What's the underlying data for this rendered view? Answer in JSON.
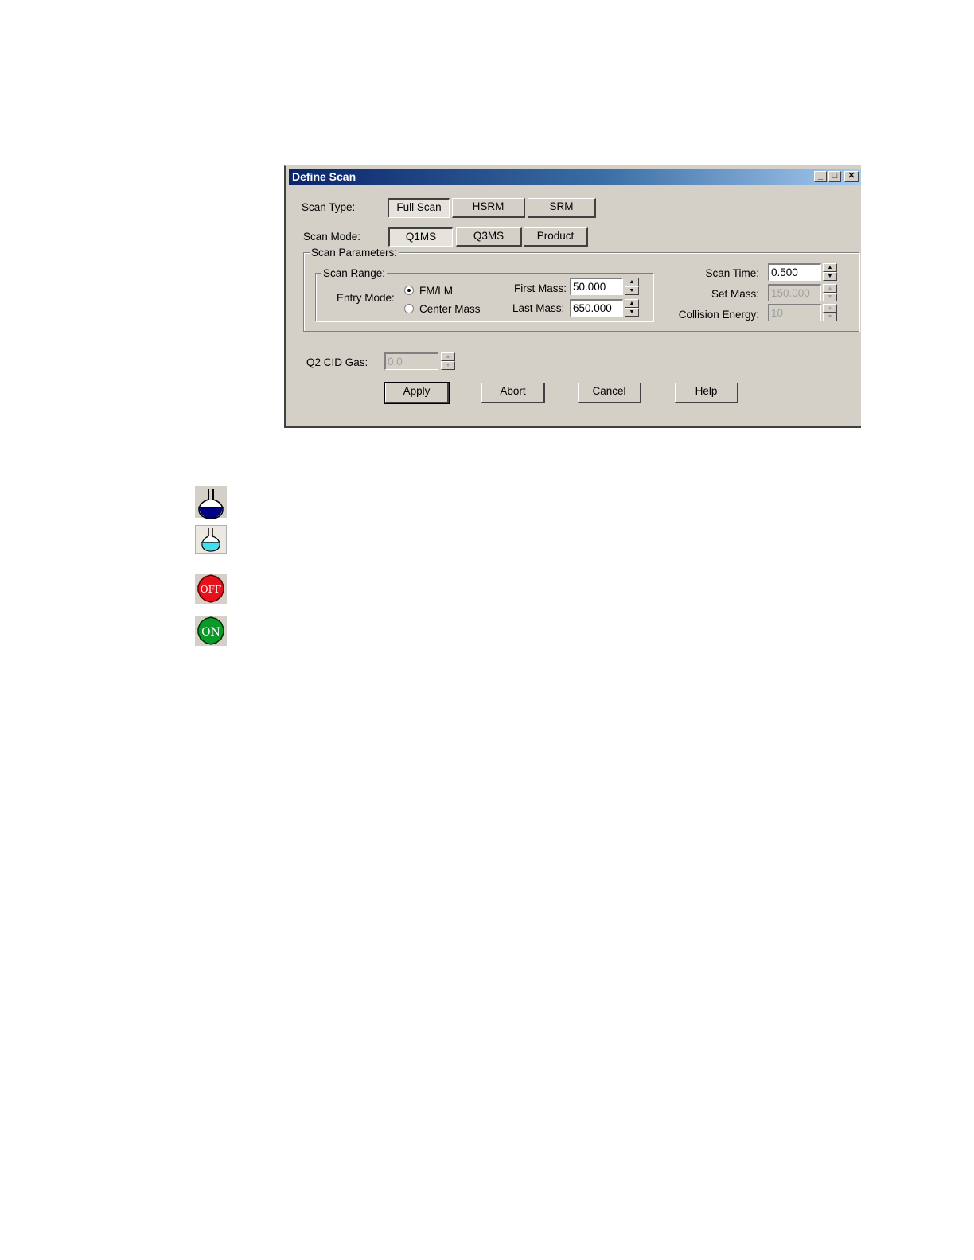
{
  "dialog": {
    "title": "Define Scan",
    "scan_type": {
      "label": "Scan Type:",
      "options": [
        "Full Scan",
        "HSRM",
        "SRM"
      ],
      "selected": "Full Scan"
    },
    "scan_mode": {
      "label": "Scan Mode:",
      "options": [
        "Q1MS",
        "Q3MS",
        "Product"
      ],
      "selected": "Q1MS"
    },
    "scan_parameters": {
      "label": "Scan Parameters:",
      "scan_range": {
        "label": "Scan Range:",
        "entry_mode_label": "Entry Mode:",
        "entry_modes": [
          "FM/LM",
          "Center Mass"
        ],
        "selected_entry_mode": "FM/LM",
        "first_mass_label": "First Mass:",
        "first_mass": "50.000",
        "last_mass_label": "Last Mass:",
        "last_mass": "650.000"
      },
      "scan_time_label": "Scan Time:",
      "scan_time": "0.500",
      "set_mass_label": "Set Mass:",
      "set_mass": "150.000",
      "collision_energy_label": "Collision Energy:",
      "collision_energy": "10"
    },
    "q2_cid_gas_label": "Q2 CID Gas:",
    "q2_cid_gas": "0.0",
    "buttons": {
      "apply": "Apply",
      "abort": "Abort",
      "cancel": "Cancel",
      "help": "Help"
    }
  },
  "icons": {
    "flask_dark": "flask-dark-blue-icon",
    "flask_light": "flask-light-cyan-icon",
    "off": "OFF",
    "on": "ON"
  },
  "colors": {
    "title_bar_start": "#0a246a",
    "title_bar_end": "#a6caf0",
    "dialog_face": "#d4d0c8",
    "off_red": "#e8101a",
    "on_green": "#0a9a2a"
  }
}
